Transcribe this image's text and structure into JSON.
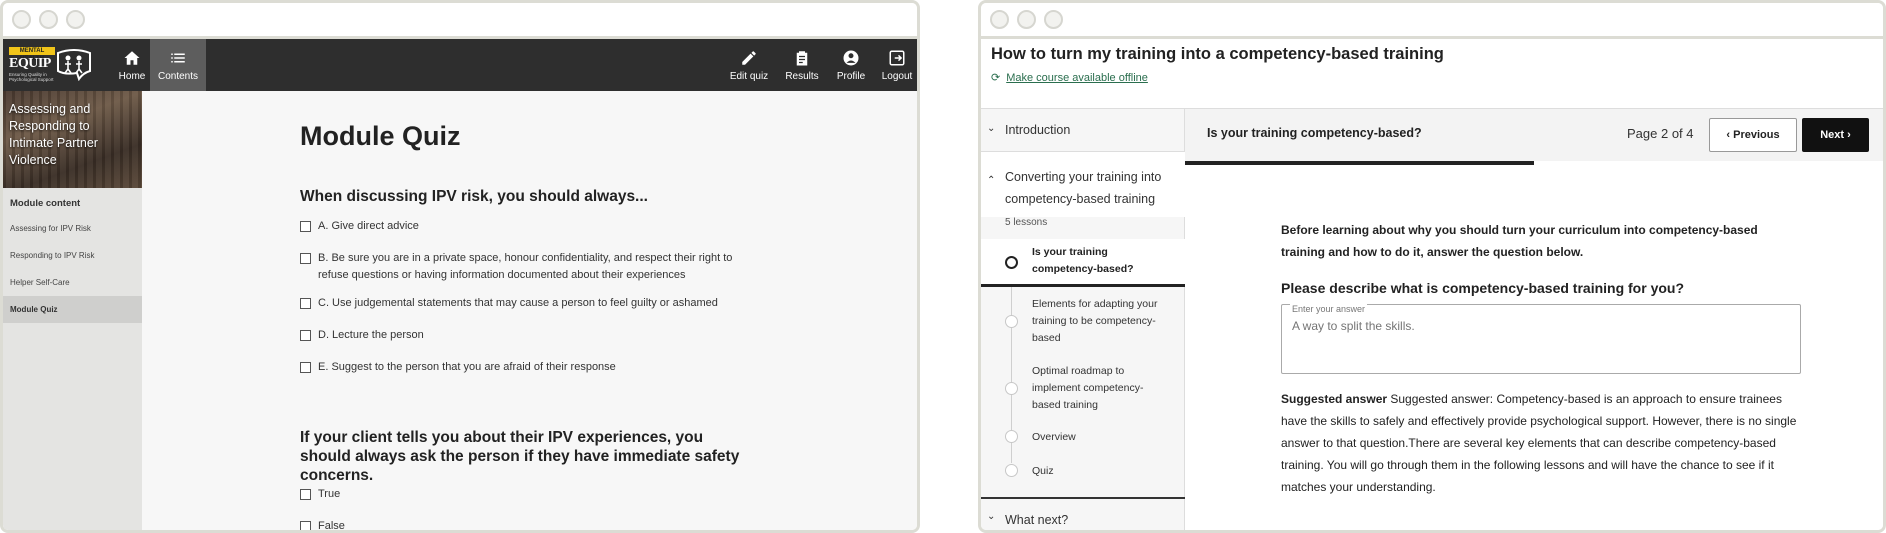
{
  "left": {
    "logo": {
      "badge": "MENTAL HEALTH",
      "word": "EQUIP",
      "tagline": "Ensuring Quality in Psychological Support"
    },
    "nav": [
      {
        "label": "Home",
        "icon": "home-icon"
      },
      {
        "label": "Contents",
        "icon": "list-icon"
      },
      {
        "label": "Edit quiz",
        "icon": "pencil-icon"
      },
      {
        "label": "Results",
        "icon": "clipboard-icon"
      },
      {
        "label": "Profile",
        "icon": "user-icon"
      },
      {
        "label": "Logout",
        "icon": "logout-icon"
      }
    ],
    "hero_title": "Assessing and Responding to Intimate Partner Violence",
    "module_content_heading": "Module content",
    "module_items": [
      "Assessing for IPV Risk",
      "Responding to IPV Risk",
      "Helper Self-Care",
      "Module Quiz"
    ],
    "quiz": {
      "title": "Module Quiz",
      "q1": "When discussing IPV risk, you should always...",
      "q1_options": [
        "A. Give direct advice",
        "B. Be sure you are in a private space, honour confidentiality, and respect their right to refuse questions or having information documented about their experiences",
        "C. Use judgemental statements that may cause a person to feel guilty or ashamed",
        "D. Lecture the person",
        "E. Suggest to the person that you are afraid of their response"
      ],
      "q2": "If your client tells you about their IPV experiences, you should always ask the person if they have immediate safety concerns.",
      "q2_options": [
        "True",
        "False"
      ]
    }
  },
  "right": {
    "course_title": "How to turn my training into a competency-based training",
    "offline_link": "Make course available offline",
    "sidebar": {
      "introduction": "Introduction",
      "section_title": "Converting your training into competency-based training",
      "lesson_count": "5 lessons",
      "lessons": [
        "Is your training competency-based?",
        "Elements for adapting your training to be competency-based",
        "Optimal roadmap to implement competency-based training",
        "Overview",
        "Quiz"
      ],
      "what_next": "What next?"
    },
    "lesson_bar": {
      "title": "Is your training competency-based?",
      "page": "Page 2 of 4",
      "previous": "Previous",
      "next": "Next",
      "progress": 0.5
    },
    "content": {
      "intro": "Before learning about why you should turn your curriculum into competency-based training and how to do it, answer the question below.",
      "prompt": "Please describe what is competency-based training for you?",
      "field_label": "Enter your answer",
      "field_placeholder": "A way to split the skills.",
      "suggested_label": "Suggested answer",
      "suggested_text": "Suggested answer: Competency-based is an approach to ensure trainees have the skills to safely and effectively provide psychological support. However, there is no single answer to that question.There are several key elements that can describe competency-based training. You will go through them in the following lessons and will have the chance to see if it matches your understanding."
    }
  }
}
